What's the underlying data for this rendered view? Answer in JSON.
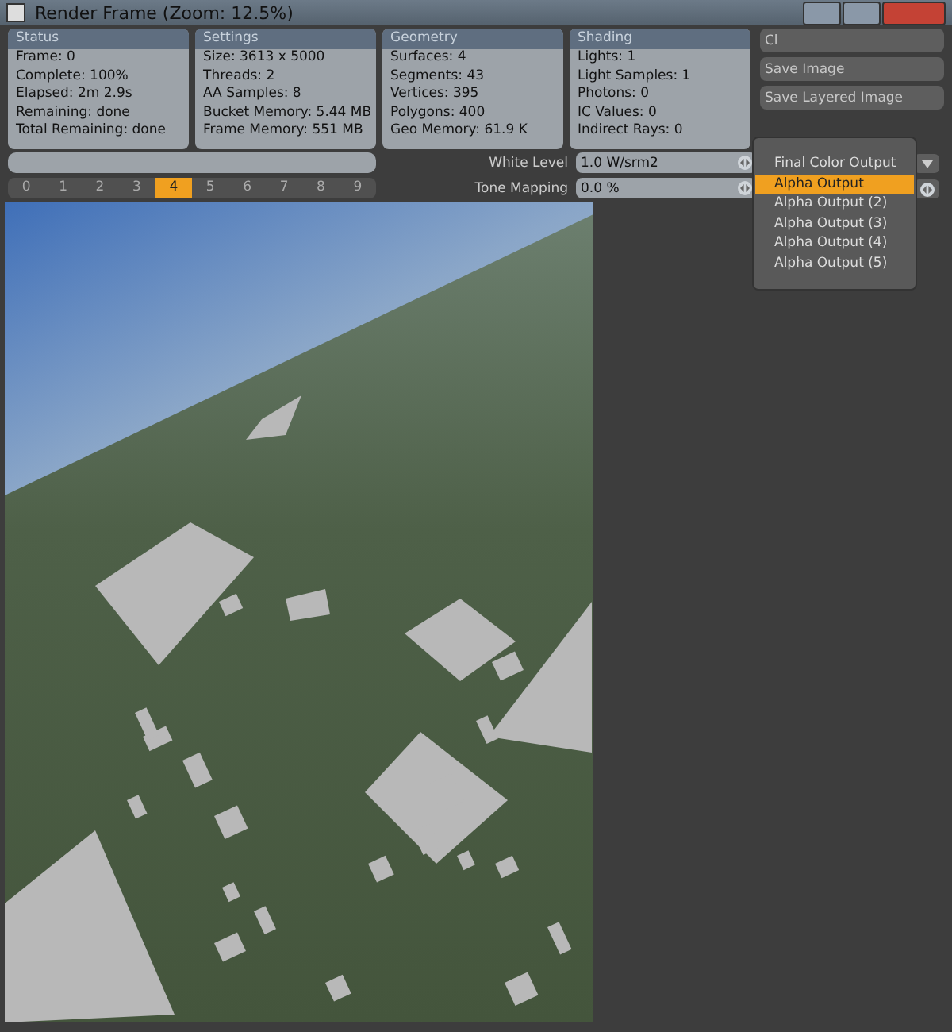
{
  "window": {
    "title": "Render Frame (Zoom: 12.5%)"
  },
  "panels": [
    {
      "title": "Status",
      "lines": [
        "Frame: 0",
        "Complete: 100%",
        "Elapsed: 2m 2.9s",
        "Remaining: done",
        "Total Remaining: done"
      ]
    },
    {
      "title": "Settings",
      "lines": [
        "Size: 3613 x 5000",
        "Threads: 2",
        "AA Samples: 8",
        "Bucket Memory: 5.44 MB",
        "Frame Memory: 551 MB"
      ]
    },
    {
      "title": "Geometry",
      "lines": [
        "Surfaces: 4",
        "Segments: 43",
        "Vertices: 395",
        "Polygons: 400",
        "Geo Memory: 61.9 K"
      ]
    },
    {
      "title": "Shading",
      "lines": [
        "Lights: 1",
        "Light Samples: 1",
        "Photons: 0",
        "IC Values: 0",
        "Indirect Rays: 0"
      ]
    }
  ],
  "buttons": [
    "Cl",
    "Save Image",
    "Save Layered Image"
  ],
  "progress": {
    "level": 0
  },
  "frames": [
    {
      "label": "0",
      "selected": false
    },
    {
      "label": "1",
      "selected": false
    },
    {
      "label": "2",
      "selected": false
    },
    {
      "label": "3",
      "selected": false
    },
    {
      "label": "4",
      "selected": true
    },
    {
      "label": "5",
      "selected": false
    },
    {
      "label": "6",
      "selected": false
    },
    {
      "label": "7",
      "selected": false
    },
    {
      "label": "8",
      "selected": false
    },
    {
      "label": "9",
      "selected": false
    }
  ],
  "fields": [
    {
      "label": "White Level",
      "value": "1.0 W/srm2"
    },
    {
      "label": "Tone Mapping",
      "value": "0.0 %"
    }
  ],
  "output_menu": [
    {
      "label": "Final Color Output",
      "selected": false
    },
    {
      "label": "Alpha Output",
      "selected": true
    },
    {
      "label": "Alpha Output (2)",
      "selected": false
    },
    {
      "label": "Alpha Output (3)",
      "selected": false
    },
    {
      "label": "Alpha Output (4)",
      "selected": false
    },
    {
      "label": "Alpha Output (5)",
      "selected": false
    }
  ]
}
